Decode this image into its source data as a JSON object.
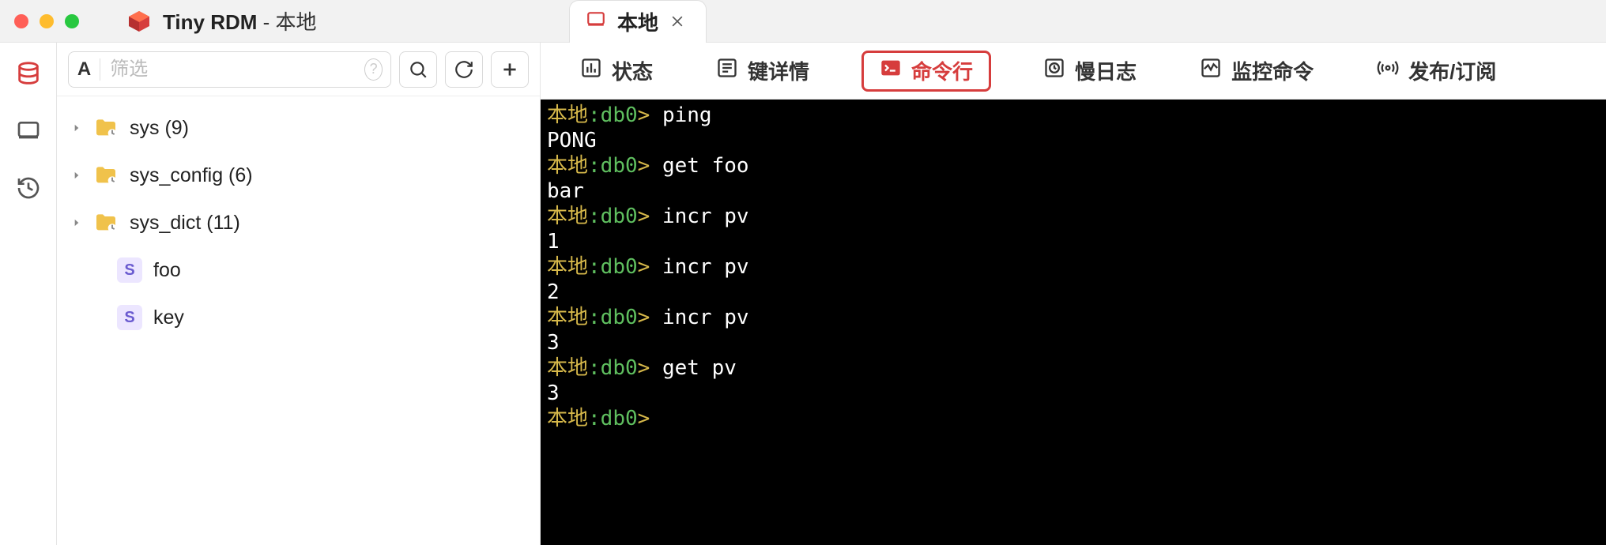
{
  "app": {
    "name": "Tiny RDM",
    "separator": " - ",
    "connection": "本地"
  },
  "connTab": {
    "label": "本地"
  },
  "rail": {
    "items": [
      {
        "name": "database"
      },
      {
        "name": "monitor"
      },
      {
        "name": "history"
      }
    ]
  },
  "toolbar": {
    "prefix": "A",
    "filterPlaceholder": "筛选",
    "help": "?"
  },
  "tree": {
    "items": [
      {
        "type": "folder",
        "label": "sys (9)"
      },
      {
        "type": "folder",
        "label": "sys_config (6)"
      },
      {
        "type": "folder",
        "label": "sys_dict (11)"
      },
      {
        "type": "string",
        "badge": "S",
        "label": "foo"
      },
      {
        "type": "string",
        "badge": "S",
        "label": "key"
      }
    ]
  },
  "tabs": {
    "items": [
      {
        "name": "status",
        "label": "状态"
      },
      {
        "name": "keydetail",
        "label": "键详情"
      },
      {
        "name": "cli",
        "label": "命令行",
        "active": true
      },
      {
        "name": "slowlog",
        "label": "慢日志"
      },
      {
        "name": "monitor",
        "label": "监控命令"
      },
      {
        "name": "pubsub",
        "label": "发布/订阅"
      }
    ]
  },
  "terminal": {
    "promptHost": "本地",
    "promptDb": ":db0",
    "promptGt": ">",
    "lines": [
      {
        "type": "cmd",
        "text": "ping"
      },
      {
        "type": "result",
        "text": "PONG"
      },
      {
        "type": "cmd",
        "text": "get foo"
      },
      {
        "type": "result",
        "text": "bar"
      },
      {
        "type": "cmd",
        "text": "incr pv"
      },
      {
        "type": "result",
        "text": "1"
      },
      {
        "type": "cmd",
        "text": "incr pv"
      },
      {
        "type": "result",
        "text": "2"
      },
      {
        "type": "cmd",
        "text": "incr pv"
      },
      {
        "type": "result",
        "text": "3"
      },
      {
        "type": "cmd",
        "text": "get pv"
      },
      {
        "type": "result",
        "text": "3"
      },
      {
        "type": "prompt"
      }
    ]
  }
}
